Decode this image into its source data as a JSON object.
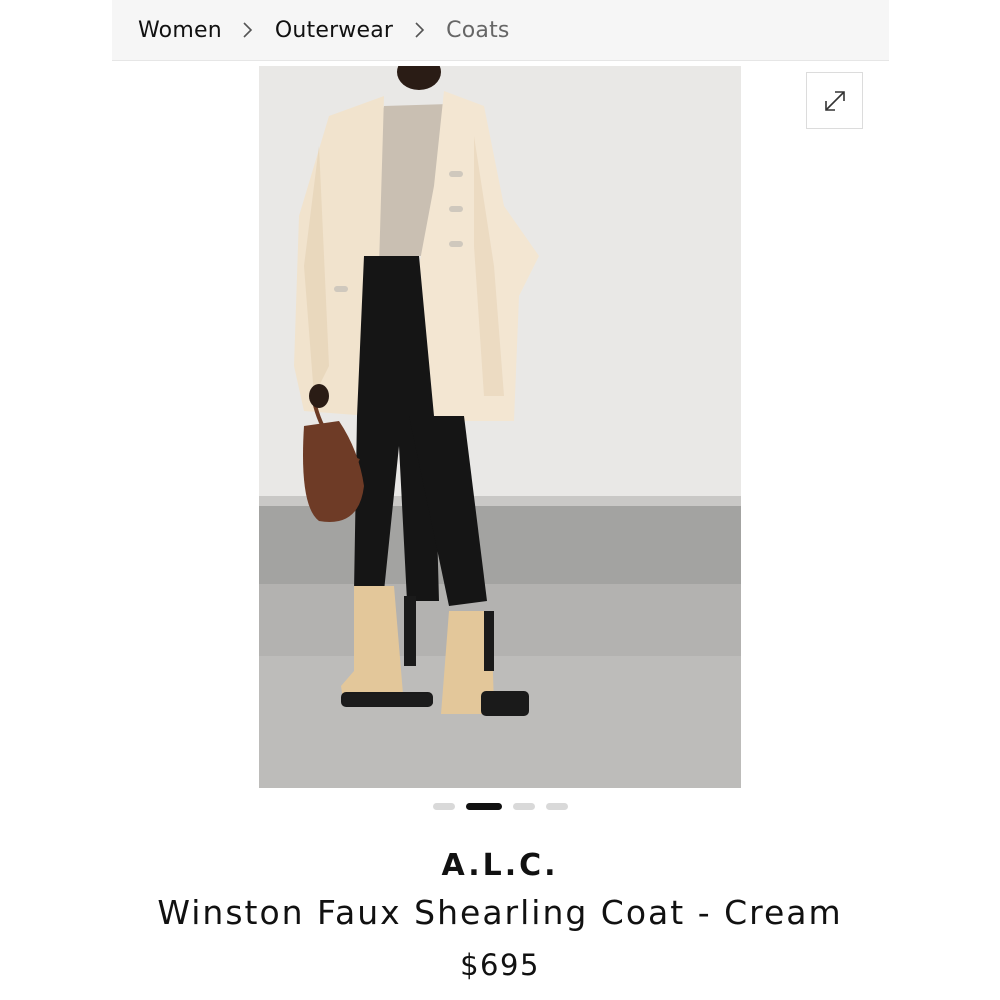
{
  "breadcrumb": {
    "items": [
      {
        "label": "Women"
      },
      {
        "label": "Outerwear"
      },
      {
        "label": "Coats"
      }
    ],
    "separator_icon": "chevron-right-icon"
  },
  "gallery": {
    "expand_icon": "expand-icon",
    "slide_count": 4,
    "active_slide": 2
  },
  "product": {
    "brand": "A.L.C.",
    "name": "Winston Faux Shearling Coat - Cream",
    "price": "$695"
  },
  "colors": {
    "breadcrumb_bg": "#f6f6f6",
    "text": "#111111",
    "dot_active": "#111111",
    "dot_inactive": "#d9d9d9"
  }
}
